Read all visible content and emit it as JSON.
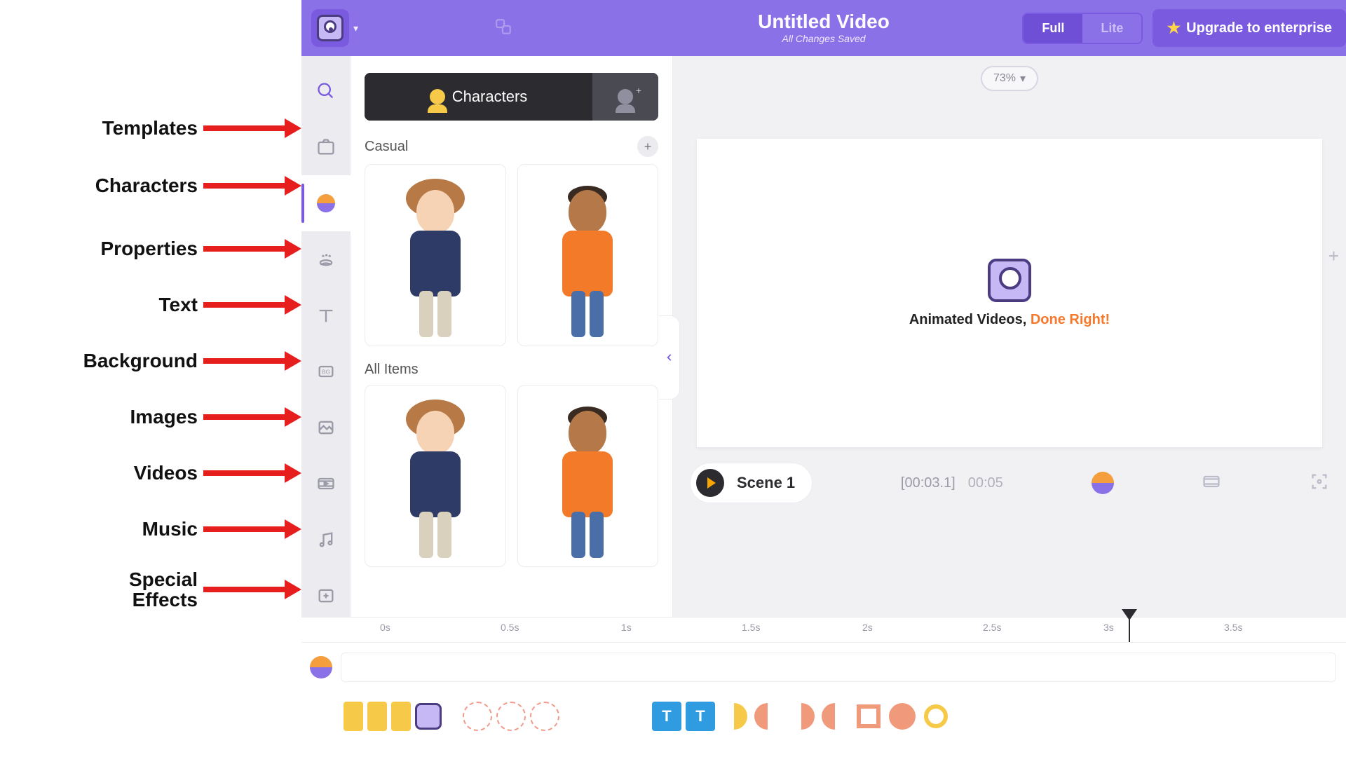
{
  "header": {
    "title": "Untitled Video",
    "subtitle": "All Changes Saved",
    "mode_full": "Full",
    "mode_lite": "Lite",
    "upgrade": "Upgrade to enterprise"
  },
  "annotations": {
    "templates": "Templates",
    "characters": "Characters",
    "properties": "Properties",
    "text": "Text",
    "background": "Background",
    "images": "Images",
    "videos": "Videos",
    "music": "Music",
    "special_effects": "Special\nEffects"
  },
  "toolbar": {
    "items": [
      {
        "id": "search",
        "name": "search-icon"
      },
      {
        "id": "templates",
        "name": "templates-icon"
      },
      {
        "id": "characters",
        "name": "characters-icon"
      },
      {
        "id": "properties",
        "name": "properties-icon"
      },
      {
        "id": "text",
        "name": "text-icon"
      },
      {
        "id": "background",
        "name": "background-icon",
        "label": "BG"
      },
      {
        "id": "images",
        "name": "images-icon"
      },
      {
        "id": "videos",
        "name": "videos-icon"
      },
      {
        "id": "music",
        "name": "music-icon"
      },
      {
        "id": "effects",
        "name": "effects-icon"
      }
    ],
    "active": "characters"
  },
  "panel": {
    "tab_primary": "Characters",
    "section_casual": "Casual",
    "section_all": "All Items"
  },
  "canvas": {
    "zoom": "73%",
    "tagline_a": "Animated Videos,",
    "tagline_b": "Done Right!"
  },
  "playbar": {
    "scene": "Scene 1",
    "current": "[00:03.1]",
    "total": "00:05"
  },
  "timeline": {
    "ticks": [
      "0s",
      "0.5s",
      "1s",
      "1.5s",
      "2s",
      "2.5s",
      "3s",
      "3.5s"
    ],
    "playhead_pos_pct": 78
  },
  "tracks": {
    "t1": "T",
    "t2": "T"
  }
}
